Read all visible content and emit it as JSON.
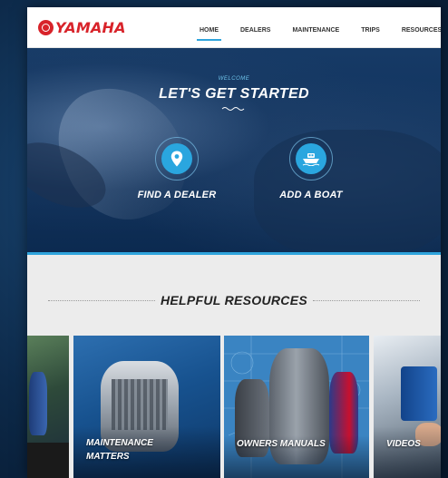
{
  "brand": {
    "name": "YAMAHA",
    "color": "#d8232a"
  },
  "nav": {
    "items": [
      {
        "label": "HOME",
        "active": true
      },
      {
        "label": "DEALERS",
        "active": false
      },
      {
        "label": "MAINTENANCE",
        "active": false
      },
      {
        "label": "TRIPS",
        "active": false
      },
      {
        "label": "RESOURCES",
        "active": false
      }
    ]
  },
  "hero": {
    "welcome": "WELCOME",
    "title": "LET'S GET STARTED",
    "actions": [
      {
        "label": "FIND A DEALER",
        "icon": "map-pin-icon"
      },
      {
        "label": "ADD A BOAT",
        "icon": "boat-icon"
      }
    ]
  },
  "resources": {
    "title": "HELPFUL RESOURCES",
    "tiles": [
      {
        "label": ""
      },
      {
        "label": "MAINTENANCE MATTERS"
      },
      {
        "label": "OWNERS MANUALS"
      },
      {
        "label": "VIDEOS"
      }
    ]
  },
  "colors": {
    "accent": "#2fa4dc",
    "hero_bg": "#10325c",
    "band_bg": "#ececec"
  }
}
